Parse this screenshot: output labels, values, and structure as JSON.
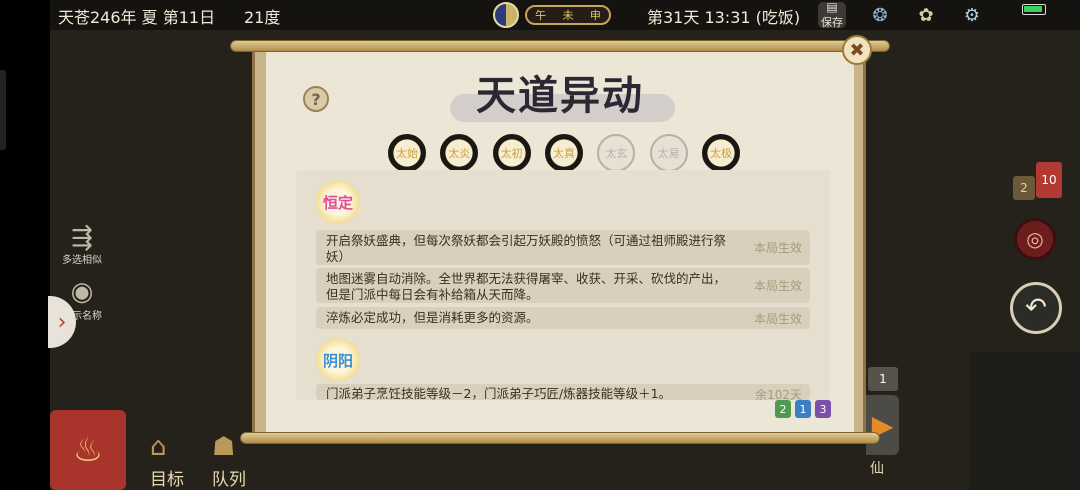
{
  "status_bar": {
    "date": "天苍246年 夏 第11日",
    "temperature": "21度",
    "shichen": [
      "午",
      "未",
      "申"
    ],
    "day_time": "第31天 13:31 (吃饭)",
    "save_label": "保存"
  },
  "left_panel": {
    "multi_select_label": "多选相似",
    "show_names_label": "显示名称"
  },
  "right_panel": {
    "badge_left": "2",
    "badge_right": "10",
    "speed_badge": "1"
  },
  "bottom_bar": {
    "goal_label": "目标",
    "team_label": "队列",
    "xian_label": "仙"
  },
  "dialog": {
    "title": "天道异动",
    "help": "?",
    "close": "✖",
    "tiers": [
      "太始",
      "太炎",
      "太初",
      "太真",
      "太玄",
      "太易",
      "太极"
    ],
    "tier_states": [
      true,
      true,
      true,
      true,
      false,
      false,
      true
    ],
    "sections": [
      {
        "tag": "恒定",
        "rows": [
          {
            "text": "开启祭妖盛典，但每次祭妖都会引起万妖殿的愤怒（可通过祖师殿进行祭妖）",
            "status": "本局生效"
          },
          {
            "text": "地图迷雾自动消除。全世界都无法获得屠宰、收获、开采、砍伐的产出，但是门派中每日会有补给箱从天而降。",
            "status": "本局生效"
          },
          {
            "text": "淬炼必定成功，但是消耗更多的资源。",
            "status": "本局生效"
          }
        ]
      },
      {
        "tag": "阴阳",
        "rows": [
          {
            "text": "门派弟子烹饪技能等级－2，门派弟子巧匠/炼器技能等级＋1。",
            "status": "余102天"
          }
        ]
      }
    ],
    "pages": [
      "2",
      "1",
      "3"
    ]
  }
}
